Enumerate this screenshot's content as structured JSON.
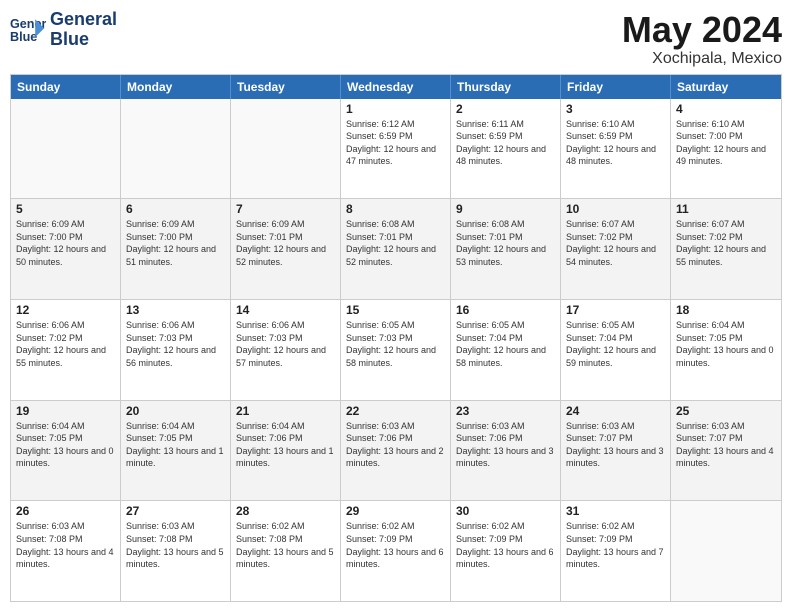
{
  "logo": {
    "line1": "General",
    "line2": "Blue"
  },
  "title": "May 2024",
  "location": "Xochipala, Mexico",
  "header_days": [
    "Sunday",
    "Monday",
    "Tuesday",
    "Wednesday",
    "Thursday",
    "Friday",
    "Saturday"
  ],
  "rows": [
    [
      {
        "day": "",
        "info": "",
        "empty": true
      },
      {
        "day": "",
        "info": "",
        "empty": true
      },
      {
        "day": "",
        "info": "",
        "empty": true
      },
      {
        "day": "1",
        "info": "Sunrise: 6:12 AM\nSunset: 6:59 PM\nDaylight: 12 hours and 47 minutes."
      },
      {
        "day": "2",
        "info": "Sunrise: 6:11 AM\nSunset: 6:59 PM\nDaylight: 12 hours and 48 minutes."
      },
      {
        "day": "3",
        "info": "Sunrise: 6:10 AM\nSunset: 6:59 PM\nDaylight: 12 hours and 48 minutes."
      },
      {
        "day": "4",
        "info": "Sunrise: 6:10 AM\nSunset: 7:00 PM\nDaylight: 12 hours and 49 minutes."
      }
    ],
    [
      {
        "day": "5",
        "info": "Sunrise: 6:09 AM\nSunset: 7:00 PM\nDaylight: 12 hours and 50 minutes."
      },
      {
        "day": "6",
        "info": "Sunrise: 6:09 AM\nSunset: 7:00 PM\nDaylight: 12 hours and 51 minutes."
      },
      {
        "day": "7",
        "info": "Sunrise: 6:09 AM\nSunset: 7:01 PM\nDaylight: 12 hours and 52 minutes."
      },
      {
        "day": "8",
        "info": "Sunrise: 6:08 AM\nSunset: 7:01 PM\nDaylight: 12 hours and 52 minutes."
      },
      {
        "day": "9",
        "info": "Sunrise: 6:08 AM\nSunset: 7:01 PM\nDaylight: 12 hours and 53 minutes."
      },
      {
        "day": "10",
        "info": "Sunrise: 6:07 AM\nSunset: 7:02 PM\nDaylight: 12 hours and 54 minutes."
      },
      {
        "day": "11",
        "info": "Sunrise: 6:07 AM\nSunset: 7:02 PM\nDaylight: 12 hours and 55 minutes."
      }
    ],
    [
      {
        "day": "12",
        "info": "Sunrise: 6:06 AM\nSunset: 7:02 PM\nDaylight: 12 hours and 55 minutes."
      },
      {
        "day": "13",
        "info": "Sunrise: 6:06 AM\nSunset: 7:03 PM\nDaylight: 12 hours and 56 minutes."
      },
      {
        "day": "14",
        "info": "Sunrise: 6:06 AM\nSunset: 7:03 PM\nDaylight: 12 hours and 57 minutes."
      },
      {
        "day": "15",
        "info": "Sunrise: 6:05 AM\nSunset: 7:03 PM\nDaylight: 12 hours and 58 minutes."
      },
      {
        "day": "16",
        "info": "Sunrise: 6:05 AM\nSunset: 7:04 PM\nDaylight: 12 hours and 58 minutes."
      },
      {
        "day": "17",
        "info": "Sunrise: 6:05 AM\nSunset: 7:04 PM\nDaylight: 12 hours and 59 minutes."
      },
      {
        "day": "18",
        "info": "Sunrise: 6:04 AM\nSunset: 7:05 PM\nDaylight: 13 hours and 0 minutes."
      }
    ],
    [
      {
        "day": "19",
        "info": "Sunrise: 6:04 AM\nSunset: 7:05 PM\nDaylight: 13 hours and 0 minutes."
      },
      {
        "day": "20",
        "info": "Sunrise: 6:04 AM\nSunset: 7:05 PM\nDaylight: 13 hours and 1 minute."
      },
      {
        "day": "21",
        "info": "Sunrise: 6:04 AM\nSunset: 7:06 PM\nDaylight: 13 hours and 1 minutes."
      },
      {
        "day": "22",
        "info": "Sunrise: 6:03 AM\nSunset: 7:06 PM\nDaylight: 13 hours and 2 minutes."
      },
      {
        "day": "23",
        "info": "Sunrise: 6:03 AM\nSunset: 7:06 PM\nDaylight: 13 hours and 3 minutes."
      },
      {
        "day": "24",
        "info": "Sunrise: 6:03 AM\nSunset: 7:07 PM\nDaylight: 13 hours and 3 minutes."
      },
      {
        "day": "25",
        "info": "Sunrise: 6:03 AM\nSunset: 7:07 PM\nDaylight: 13 hours and 4 minutes."
      }
    ],
    [
      {
        "day": "26",
        "info": "Sunrise: 6:03 AM\nSunset: 7:08 PM\nDaylight: 13 hours and 4 minutes."
      },
      {
        "day": "27",
        "info": "Sunrise: 6:03 AM\nSunset: 7:08 PM\nDaylight: 13 hours and 5 minutes."
      },
      {
        "day": "28",
        "info": "Sunrise: 6:02 AM\nSunset: 7:08 PM\nDaylight: 13 hours and 5 minutes."
      },
      {
        "day": "29",
        "info": "Sunrise: 6:02 AM\nSunset: 7:09 PM\nDaylight: 13 hours and 6 minutes."
      },
      {
        "day": "30",
        "info": "Sunrise: 6:02 AM\nSunset: 7:09 PM\nDaylight: 13 hours and 6 minutes."
      },
      {
        "day": "31",
        "info": "Sunrise: 6:02 AM\nSunset: 7:09 PM\nDaylight: 13 hours and 7 minutes."
      },
      {
        "day": "",
        "info": "",
        "empty": true
      }
    ]
  ]
}
